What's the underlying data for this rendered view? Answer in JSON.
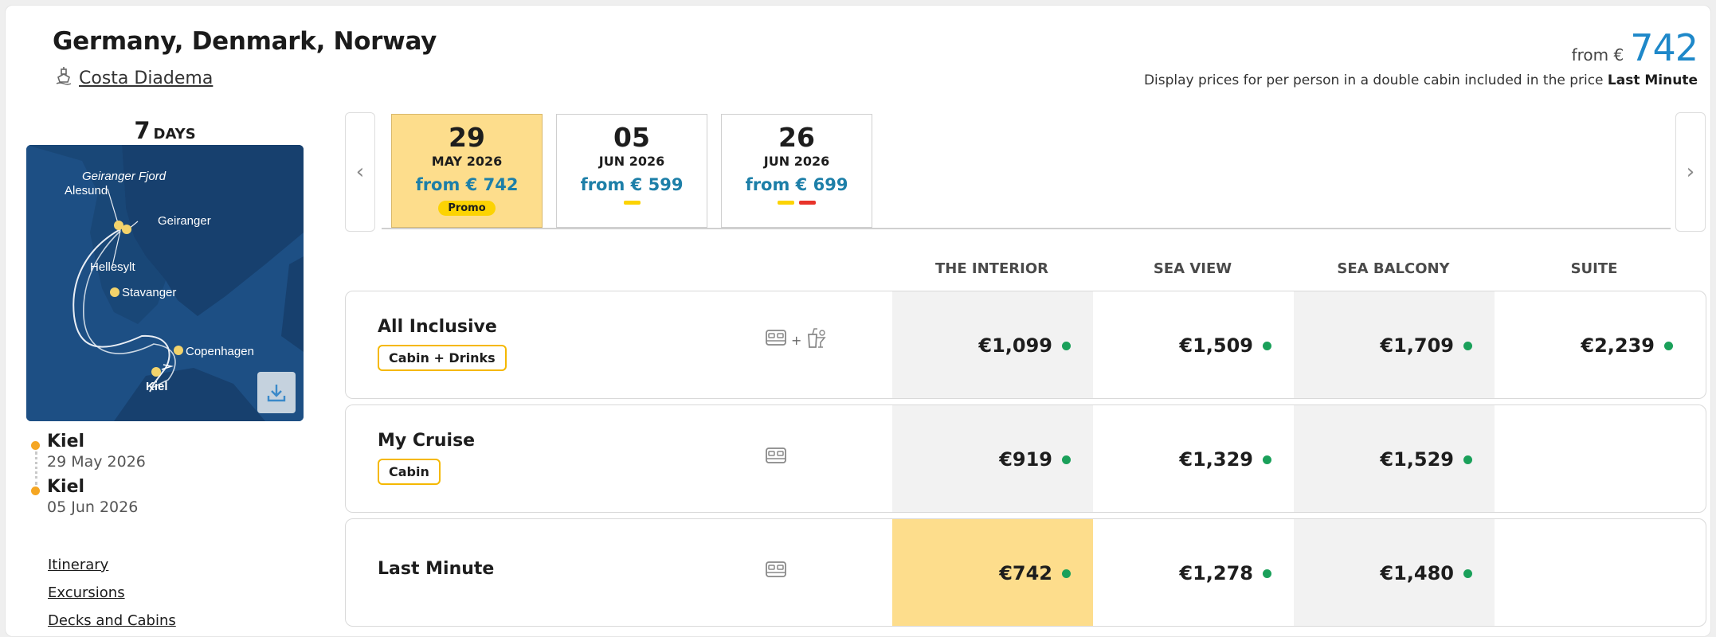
{
  "header": {
    "title": "Germany, Denmark, Norway",
    "ship": "Costa Diadema",
    "from_prefix": "from €",
    "from_price": "742",
    "disclaimer_text": "Display prices for per person in a double cabin included in the price",
    "disclaimer_bold": "Last Minute"
  },
  "itinerary": {
    "days_num": "7",
    "days_unit": "DAYS",
    "map_labels": {
      "geiranger_fjord": "Geiranger Fjord",
      "alesund": "Alesund",
      "geiranger": "Geiranger",
      "hellesylt": "Hellesylt",
      "stavanger": "Stavanger",
      "copenhagen": "Copenhagen",
      "kiel": "Kiel"
    },
    "ports": [
      {
        "name": "Kiel",
        "date": "29 May 2026"
      },
      {
        "name": "Kiel",
        "date": "05 Jun 2026"
      }
    ],
    "links": [
      "Itinerary",
      "Excursions",
      "Decks and Cabins"
    ]
  },
  "dates": [
    {
      "day": "29",
      "month": "MAY 2026",
      "price": "from € 742",
      "badge": "Promo",
      "marks": []
    },
    {
      "day": "05",
      "month": "JUN 2026",
      "price": "from € 599",
      "marks": [
        "#fcd303"
      ]
    },
    {
      "day": "26",
      "month": "JUN 2026",
      "price": "from € 699",
      "marks": [
        "#fcd303",
        "#e8332a"
      ]
    }
  ],
  "columns": [
    "THE INTERIOR",
    "SEA VIEW",
    "SEA BALCONY",
    "SUITE"
  ],
  "rows": [
    {
      "label": "All Inclusive",
      "badge": "Cabin + Drinks",
      "amenities": "bed-icon + drinks-icon",
      "prices": [
        "€1,099",
        "€1,509",
        "€1,709",
        "€2,239"
      ]
    },
    {
      "label": "My Cruise",
      "badge": "Cabin",
      "amenities": "bed-icon",
      "prices": [
        "€919",
        "€1,329",
        "€1,529"
      ]
    },
    {
      "label": "Last Minute",
      "amenities": "bed-icon",
      "prices": [
        "€742",
        "€1,278",
        "€1,480"
      ]
    }
  ],
  "colors": {
    "accent_blue": "#1e88c9",
    "price_teal": "#1d7fa8",
    "highlight_yellow": "#fddd8c",
    "promo_yellow": "#fcd303",
    "status_green": "#1aa05a",
    "marker_red": "#e8332a",
    "port_orange": "#f5a623"
  }
}
